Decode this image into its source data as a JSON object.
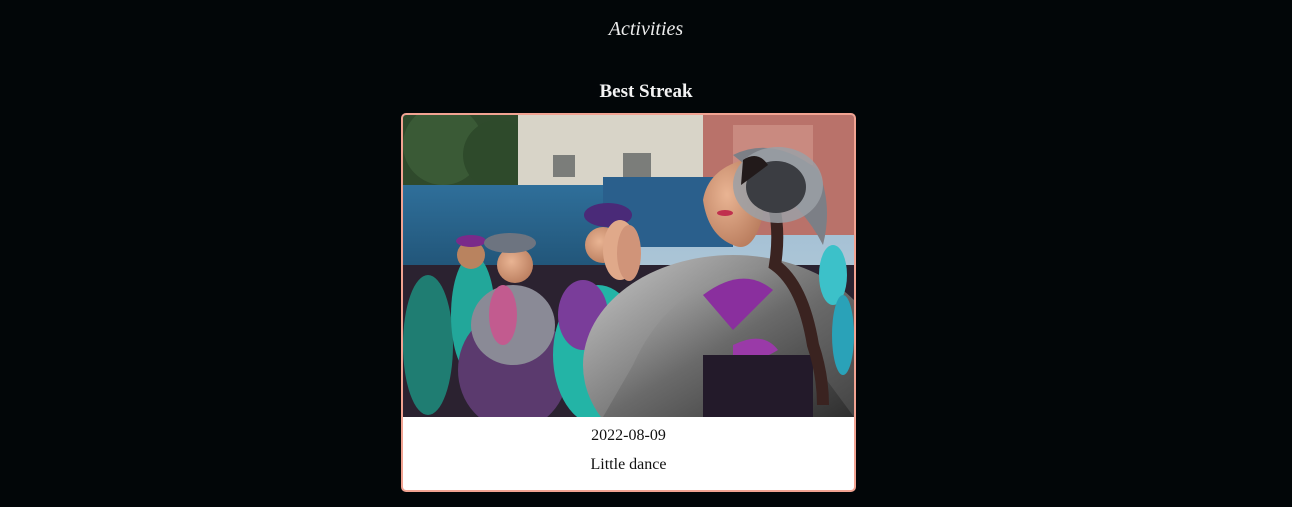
{
  "page": {
    "title": "Activities"
  },
  "section": {
    "title": "Best Streak"
  },
  "card": {
    "date": "2022-08-09",
    "caption": "Little dance",
    "border_color": "#f2a392"
  },
  "colors": {
    "background": "#020608",
    "heading_text": "#f3f3f3"
  }
}
